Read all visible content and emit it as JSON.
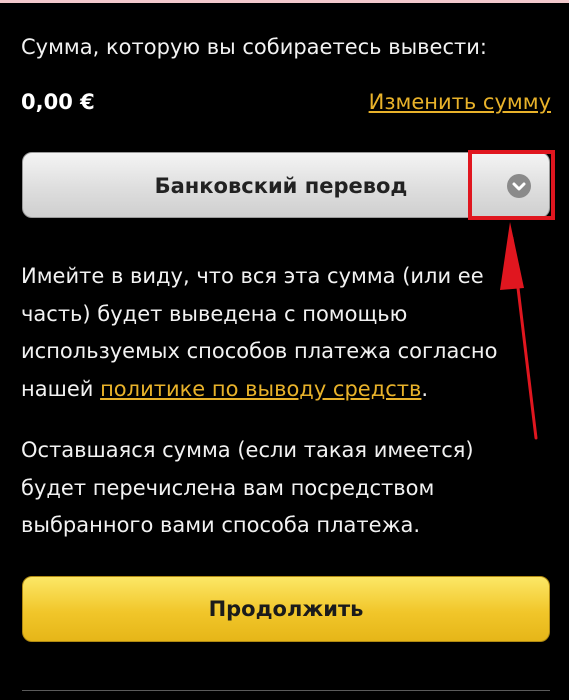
{
  "withdraw": {
    "amount_label": "Сумма, которую вы собираетесь вывести:",
    "amount_value": "0,00 €",
    "change_amount_link": "Изменить сумму"
  },
  "method_select": {
    "selected": "Банковский перевод",
    "icon": "chevron-down-icon"
  },
  "notice": {
    "line1": "Имейте в виду, что вся эта сумма (или ее",
    "line2": "часть) будет выведена с помощью",
    "line3": "используемых способов платежа согласно",
    "line4_prefix": "нашей ",
    "policy_link": "политике по выводу средств",
    "line4_suffix": "."
  },
  "remaining": {
    "line1": "Оставшаяся сумма (если такая имеется)",
    "line2": "будет перечислена вам посредством",
    "line3": "выбранного вами способа платежа."
  },
  "continue_button": "Продолжить",
  "annotation": {
    "color": "#e0161f"
  },
  "colors": {
    "background": "#000000",
    "link": "#e8b22a",
    "primary_button": "#f1c62a"
  }
}
